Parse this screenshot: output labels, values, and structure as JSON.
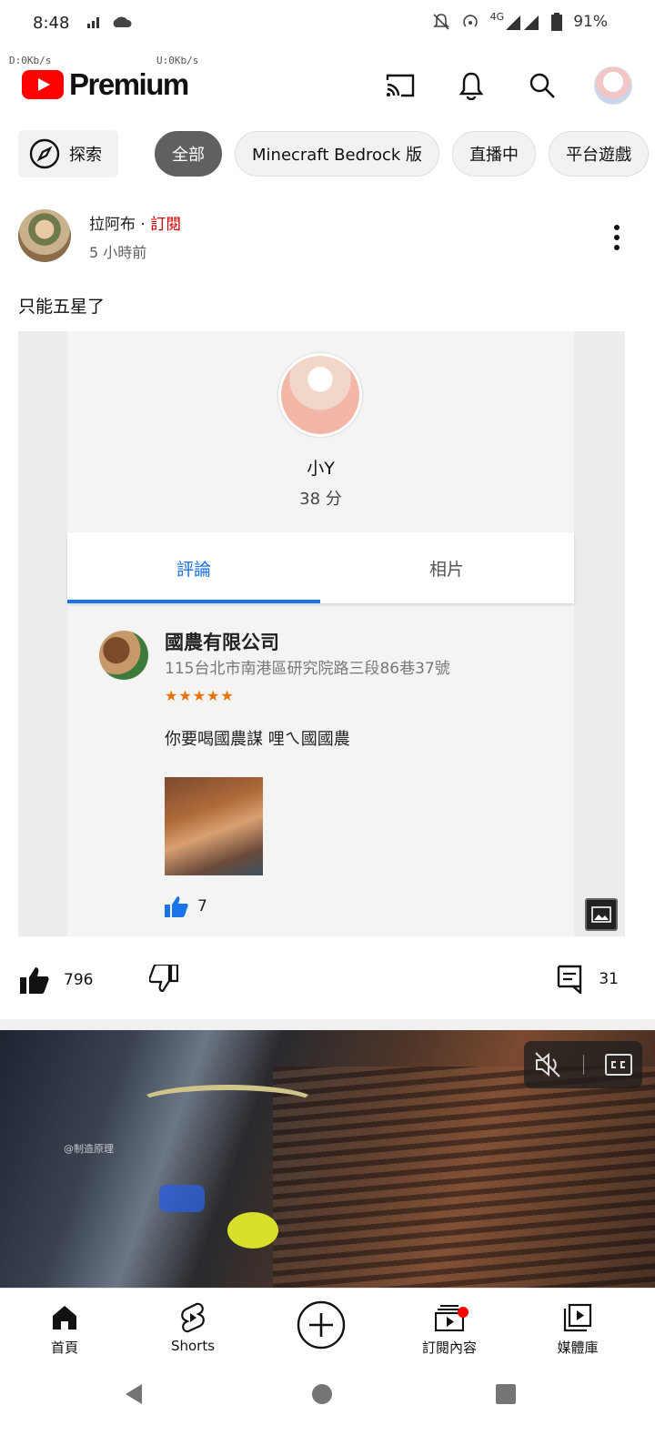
{
  "status_bar": {
    "time": "8:48",
    "network": "4G",
    "battery": "91%",
    "net_speed_left": "D:0Kb/s",
    "net_speed_right": "U:0Kb/s"
  },
  "header": {
    "logo_text": "Premium"
  },
  "chips": {
    "explore": "探索",
    "items": [
      "全部",
      "Minecraft Bedrock 版",
      "直播中",
      "平台遊戲"
    ]
  },
  "post": {
    "channel": "拉阿布",
    "separator": "·",
    "subscribe": "訂閱",
    "time": "5 小時前",
    "text": "只能五星了",
    "image": {
      "profile_name": "小Y",
      "profile_score": "38 分",
      "tabs": [
        "評論",
        "相片"
      ],
      "review_title": "國農有限公司",
      "review_address": "115台北市南港區研究院路三段86巷37號",
      "review_stars": "★★★★★",
      "review_rating": 5,
      "review_text": "你要喝國農謀 哩ㄟ國國農",
      "review_likes": "7"
    },
    "likes": "796",
    "comments": "31"
  },
  "video": {
    "watermark": "@制造原理"
  },
  "bottom_nav": {
    "home": "首頁",
    "shorts": "Shorts",
    "subscriptions": "訂閱內容",
    "library": "媒體庫"
  }
}
